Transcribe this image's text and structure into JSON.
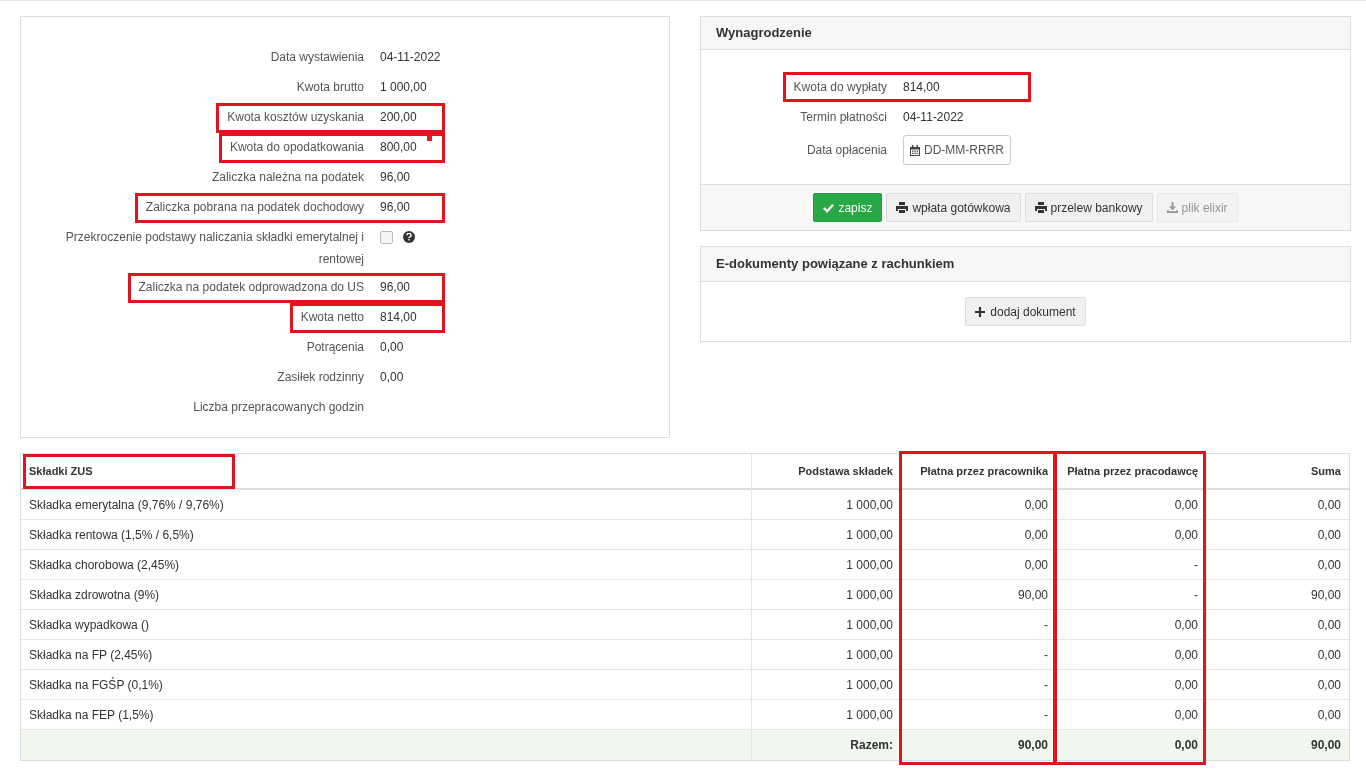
{
  "details": {
    "rows": [
      {
        "label": "Data wystawienia",
        "value": "04-11-2022",
        "highlighted": false
      },
      {
        "label": "Kwota brutto",
        "value": "1 000,00",
        "highlighted": false
      },
      {
        "label": "Kwota kosztów uzyskania",
        "value": "200,00",
        "highlighted": true
      },
      {
        "label": "Kwota do opodatkowania",
        "value": "800,00",
        "highlighted": true
      },
      {
        "label": "Zaliczka należna na podatek",
        "value": "96,00",
        "highlighted": false
      },
      {
        "label": "Zaliczka pobrana na podatek dochodowy",
        "value": "96,00",
        "highlighted": true
      },
      {
        "label": "Przekroczenie podstawy naliczania składki emerytalnej i rentowej",
        "kind": "checkbox",
        "checked": false,
        "highlighted": false
      },
      {
        "label": "Zaliczka na podatek odprowadzona do US",
        "value": "96,00",
        "highlighted": true
      },
      {
        "label": "Kwota netto",
        "value": "814,00",
        "highlighted": true
      },
      {
        "label": "Potrącenia",
        "value": "0,00",
        "highlighted": false
      },
      {
        "label": "Zasiłek rodzinny",
        "value": "0,00",
        "highlighted": false
      },
      {
        "label": "Liczba przepracowanych godzin",
        "highlighted": false
      }
    ]
  },
  "salary": {
    "title": "Wynagrodzenie",
    "rows": [
      {
        "label": "Kwota do wypłaty",
        "value": "814,00",
        "highlighted": true
      },
      {
        "label": "Termin płatności",
        "value": "04-11-2022",
        "highlighted": false
      },
      {
        "label": "Data opłacenia",
        "kind": "date",
        "placeholder": "DD-MM-RRRR",
        "highlighted": false
      }
    ],
    "buttons": [
      {
        "label": "zapisz",
        "kind": "save",
        "disabled": false
      },
      {
        "label": "wpłata gotówkowa",
        "kind": "print",
        "disabled": false
      },
      {
        "label": "przelew bankowy",
        "kind": "print",
        "disabled": false
      },
      {
        "label": "plik elixir",
        "kind": "download",
        "disabled": true
      }
    ]
  },
  "edocuments": {
    "title": "E-dokumenty powiązane z rachunkiem",
    "button": "dodaj dokument"
  },
  "table": {
    "columns": [
      {
        "label": "Składki ZUS",
        "highlighted": true
      },
      {
        "label": "Podstawa składek",
        "highlighted": false
      },
      {
        "label": "Płatna przez pracownika",
        "highlighted": true
      },
      {
        "label": "Płatna przez pracodawcę",
        "highlighted": true
      },
      {
        "label": "Suma",
        "highlighted": false
      }
    ],
    "rows": [
      [
        "Składka emerytalna (9,76% / 9,76%)",
        "1 000,00",
        "0,00",
        "0,00",
        "0,00"
      ],
      [
        "Składka rentowa (1,5% / 6,5%)",
        "1 000,00",
        "0,00",
        "0,00",
        "0,00"
      ],
      [
        "Składka chorobowa (2,45%)",
        "1 000,00",
        "0,00",
        "-",
        "0,00"
      ],
      [
        "Składka zdrowotna (9%)",
        "1 000,00",
        "90,00",
        "-",
        "90,00"
      ],
      [
        "Składka wypadkowa ()",
        "1 000,00",
        "-",
        "0,00",
        "0,00"
      ],
      [
        "Składka na FP (2,45%)",
        "1 000,00",
        "-",
        "0,00",
        "0,00"
      ],
      [
        "Składka na FGŚP (0,1%)",
        "1 000,00",
        "-",
        "0,00",
        "0,00"
      ],
      [
        "Składka na FEP (1,5%)",
        "1 000,00",
        "-",
        "0,00",
        "0,00"
      ]
    ],
    "total": {
      "label": "Razem:",
      "values": [
        "90,00",
        "0,00",
        "90,00"
      ]
    }
  }
}
